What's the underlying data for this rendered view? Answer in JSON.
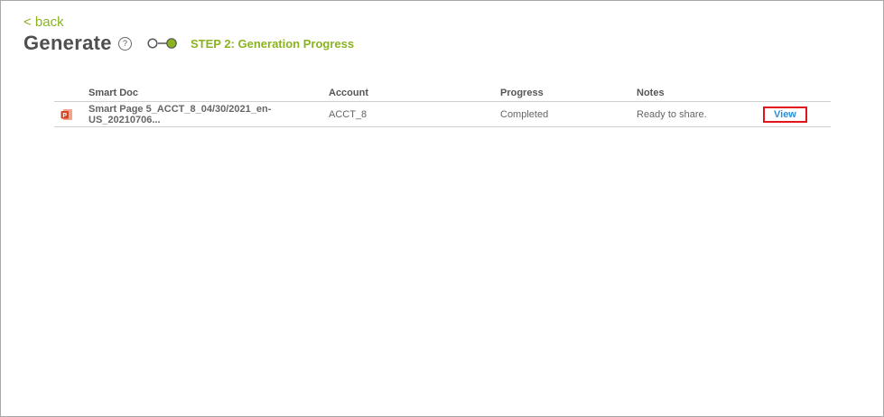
{
  "header": {
    "back_label": "< back",
    "title": "Generate",
    "help_symbol": "?",
    "step_label": "STEP 2: Generation Progress"
  },
  "table": {
    "columns": [
      "",
      "Smart Doc",
      "Account",
      "Progress",
      "Notes",
      ""
    ],
    "rows": [
      {
        "icon": "powerpoint-icon",
        "smart_doc": "Smart Page 5_ACCT_8_04/30/2021_en-US_20210706...",
        "account": "ACCT_8",
        "progress": "Completed",
        "notes": "Ready to share.",
        "action": "View"
      }
    ]
  },
  "colors": {
    "accent_green": "#8ab31f",
    "link_blue": "#2a8fd6",
    "highlight_red": "#e3141b",
    "ppt_orange": "#d24726"
  }
}
